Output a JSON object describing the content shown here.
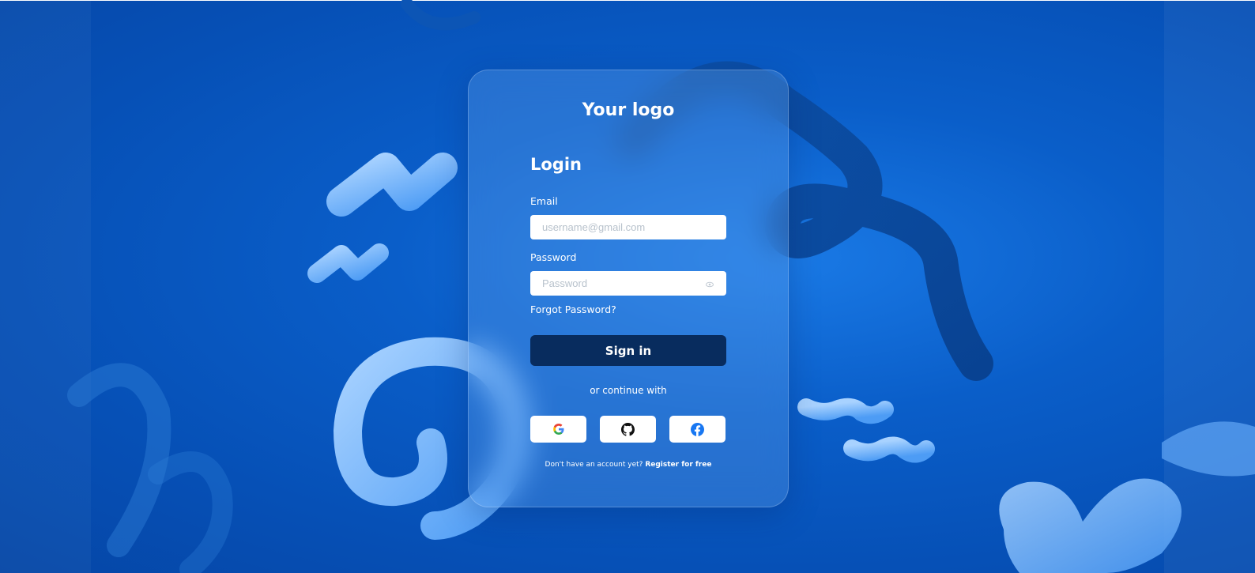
{
  "brand": {
    "logo_text": "Your logo"
  },
  "login": {
    "title": "Login",
    "email_label": "Email",
    "email_placeholder": "username@gmail.com",
    "email_value": "",
    "password_label": "Password",
    "password_placeholder": "Password",
    "password_value": "",
    "forgot_label": "Forgot Password?",
    "signin_label": "Sign in",
    "or_text": "or continue with",
    "social": [
      {
        "name": "google",
        "icon": "google-icon"
      },
      {
        "name": "github",
        "icon": "github-icon"
      },
      {
        "name": "facebook",
        "icon": "facebook-icon"
      }
    ],
    "no_account_text": "Don't have an account yet?",
    "register_label": "Register for free"
  },
  "colors": {
    "background": "#0a5ec9",
    "button": "#082c5e",
    "accent_shapes": "#6fb4ff",
    "facebook": "#1877f2"
  }
}
